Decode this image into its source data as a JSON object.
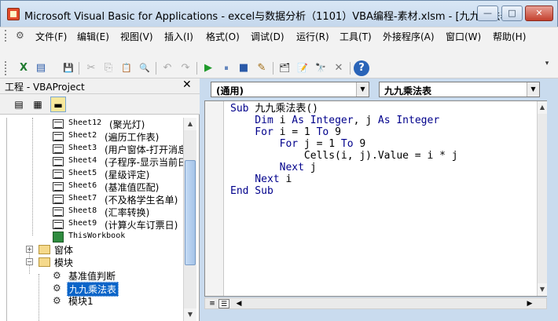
{
  "window": {
    "title": "Microsoft Visual Basic for Applications - excel与数据分析（1101）VBA编程-素材.xlsm - [九九乘法表...",
    "minimize": "—",
    "maximize": "□",
    "close": "✕"
  },
  "menu": {
    "items": [
      "文件(F)",
      "编辑(E)",
      "视图(V)",
      "插入(I)",
      "格式(O)",
      "调试(D)",
      "运行(R)",
      "工具(T)",
      "外接程序(A)",
      "窗口(W)",
      "帮助(H)"
    ],
    "right_controls": [
      "_",
      "⧉",
      "×"
    ]
  },
  "toolbar": {
    "icons": [
      "excel-icon",
      "insert-form-icon",
      "save-icon",
      "cut-icon",
      "copy-icon",
      "paste-icon",
      "find-icon",
      "undo-icon",
      "redo-icon",
      "run-icon",
      "break-icon",
      "reset-icon",
      "design-mode-icon",
      "project-explorer-icon",
      "properties-icon",
      "object-browser-icon",
      "toolbox-icon",
      "help-icon"
    ],
    "glyphs": [
      "X",
      "▤",
      "💾",
      "✂",
      "⎘",
      "📋",
      "🔍",
      "↶",
      "↷",
      "▶",
      "⏸",
      "■",
      "✎",
      "🗂",
      "📝",
      "🔭",
      "✕",
      "?"
    ]
  },
  "project": {
    "title": "工程 - VBAProject",
    "close": "✕",
    "sheets": [
      {
        "name": "Sheet12",
        "label": "(聚光灯)"
      },
      {
        "name": "Sheet2",
        "label": "(遍历工作表)"
      },
      {
        "name": "Sheet3",
        "label": "(用户窗体-打开消息"
      },
      {
        "name": "Sheet4",
        "label": "(子程序-显示当前日"
      },
      {
        "name": "Sheet5",
        "label": "(星级评定)"
      },
      {
        "name": "Sheet6",
        "label": "(基准值匹配)"
      },
      {
        "name": "Sheet7",
        "label": "(不及格学生名单)"
      },
      {
        "name": "Sheet8",
        "label": "(汇率转换)"
      },
      {
        "name": "Sheet9",
        "label": "(计算火车订票日)"
      }
    ],
    "workbook": "ThisWorkbook",
    "folders": {
      "forms": "窗体",
      "modules": "模块"
    },
    "modules": [
      "基准值判断",
      "九九乘法表",
      "模块1"
    ],
    "selected_module": "九九乘法表"
  },
  "code": {
    "object_combo": "(通用)",
    "proc_combo": "九九乘法表",
    "lines": [
      [
        {
          "t": "Sub ",
          "k": true
        },
        {
          "t": "九九乘法表()",
          "k": false
        }
      ],
      [
        {
          "t": "    Dim ",
          "k": true
        },
        {
          "t": "i ",
          "k": false
        },
        {
          "t": "As Integer",
          "k": true
        },
        {
          "t": ", j ",
          "k": false
        },
        {
          "t": "As Integer",
          "k": true
        }
      ],
      [
        {
          "t": "    For ",
          "k": true
        },
        {
          "t": "i = 1 ",
          "k": false
        },
        {
          "t": "To ",
          "k": true
        },
        {
          "t": "9",
          "k": false
        }
      ],
      [
        {
          "t": "        For ",
          "k": true
        },
        {
          "t": "j = 1 ",
          "k": false
        },
        {
          "t": "To ",
          "k": true
        },
        {
          "t": "9",
          "k": false
        }
      ],
      [
        {
          "t": "            Cells(i, j).Value = i * j",
          "k": false
        }
      ],
      [
        {
          "t": "        Next ",
          "k": true
        },
        {
          "t": "j",
          "k": false
        }
      ],
      [
        {
          "t": "    Next ",
          "k": true
        },
        {
          "t": "i",
          "k": false
        }
      ],
      [
        {
          "t": "End Sub",
          "k": true
        }
      ]
    ]
  }
}
